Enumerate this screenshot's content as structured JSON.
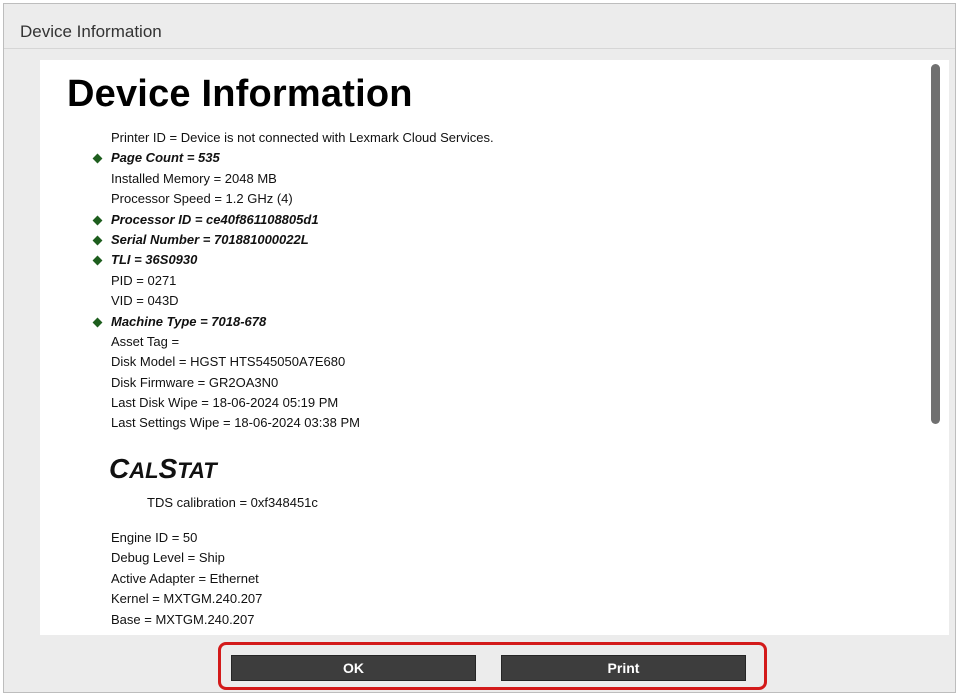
{
  "dialog": {
    "title": "Device Information",
    "heading": "Device Information",
    "info": [
      {
        "text": "Printer ID = Device is not connected with Lexmark Cloud Services.",
        "highlight": false
      },
      {
        "text": "Page Count = 535",
        "highlight": true
      },
      {
        "text": "Installed Memory = 2048 MB",
        "highlight": false
      },
      {
        "text": "Processor Speed = 1.2 GHz (4)",
        "highlight": false
      },
      {
        "text": "Processor ID = ce40f861108805d1",
        "highlight": true
      },
      {
        "text": "Serial Number = 701881000022L",
        "highlight": true
      },
      {
        "text": "TLI = 36S0930",
        "highlight": true
      },
      {
        "text": "PID = 0271",
        "highlight": false
      },
      {
        "text": "VID = 043D",
        "highlight": false
      },
      {
        "text": "Machine Type = 7018-678",
        "highlight": true
      },
      {
        "text": "Asset Tag =",
        "highlight": false
      },
      {
        "text": "Disk Model = HGST HTS545050A7E680",
        "highlight": false
      },
      {
        "text": "Disk Firmware = GR2OA3N0",
        "highlight": false
      },
      {
        "text": "Last Disk Wipe = 18-06-2024 05:19 PM",
        "highlight": false
      },
      {
        "text": "Last Settings Wipe = 18-06-2024 03:38 PM",
        "highlight": false
      }
    ],
    "calstat": {
      "cap1": "C",
      "rest1": "AL",
      "cap2": "S",
      "rest2": "TAT",
      "tds": "TDS calibration = 0xf348451c"
    },
    "info2": [
      {
        "text": "Engine ID = 50"
      },
      {
        "text": "Debug Level = Ship"
      },
      {
        "text": "Active Adapter = Ethernet"
      },
      {
        "text": "Kernel = MXTGM.240.207"
      },
      {
        "text": "Base = MXTGM.240.207"
      }
    ],
    "buttons": {
      "ok": "OK",
      "print": "Print"
    }
  }
}
